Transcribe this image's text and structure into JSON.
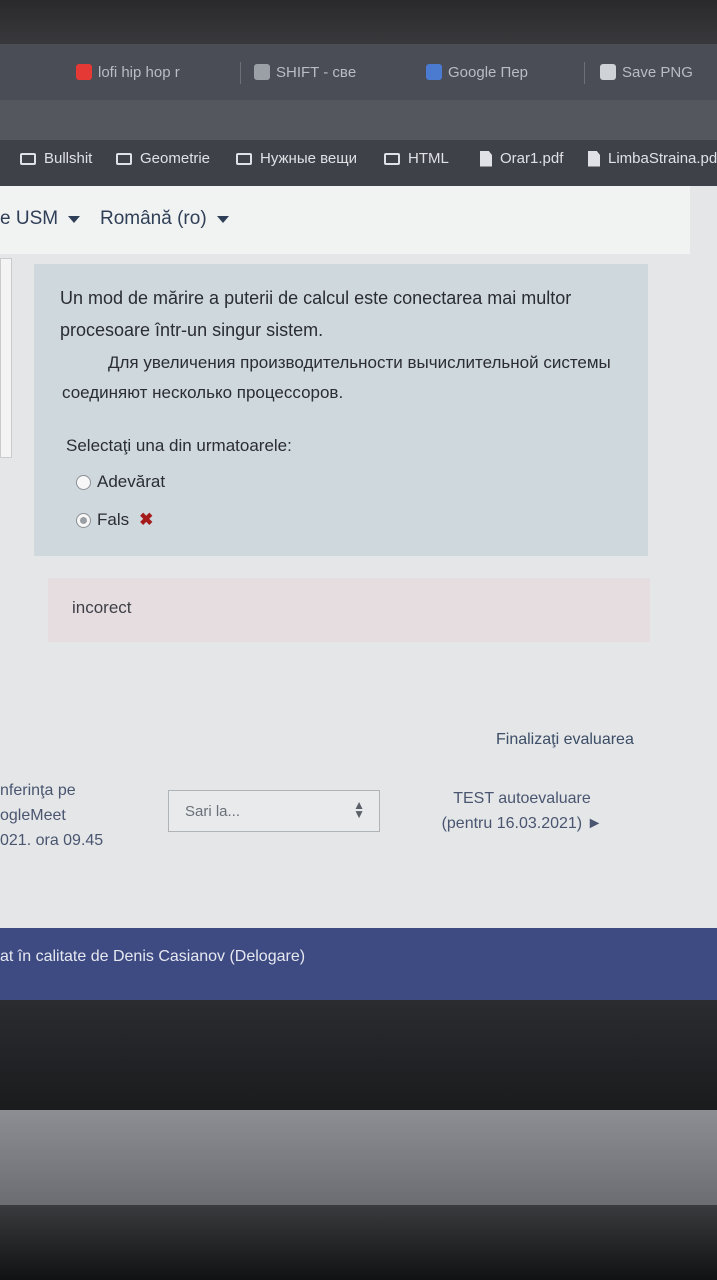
{
  "browser": {
    "tabs": [
      {
        "label": "lofi hip hop r",
        "icon": "youtube-icon",
        "color": "#e53935"
      },
      {
        "label": "SHIFT - свe",
        "icon": "page-icon",
        "color": "#9aa0a6"
      },
      {
        "label": "Google Пер",
        "icon": "translate-icon",
        "color": "#4a7bd0"
      },
      {
        "label": "Save PNG",
        "icon": "image-icon",
        "color": "#cfd2d6"
      }
    ],
    "bookmarks": [
      {
        "label": "Bullshit",
        "icon": "folder-icon"
      },
      {
        "label": "Geometrie",
        "icon": "folder-icon"
      },
      {
        "label": "Нужные вещи",
        "icon": "folder-icon"
      },
      {
        "label": "HTML",
        "icon": "folder-icon"
      },
      {
        "label": "Orar1.pdf",
        "icon": "file-icon"
      },
      {
        "label": "LimbaStraina.pd",
        "icon": "file-icon"
      }
    ]
  },
  "navbar": {
    "site_label": "e USM",
    "language_label": "Română (ro)"
  },
  "question": {
    "text_ro": " Un mod de mărire a puterii de calcul este conectarea mai multor procesoare într-un singur sistem.",
    "text_ru": "Для увеличения производительности вычислительной системы соединяют несколько процессоров.",
    "prompt": "Selectaţi una din urmatoarele:",
    "options": [
      {
        "label": "Adevărat",
        "checked": false
      },
      {
        "label": "Fals",
        "checked": true,
        "mark": "✖"
      }
    ]
  },
  "feedback": {
    "text": "incorect"
  },
  "navigation": {
    "finish_label": "Finalizaţi evaluarea",
    "prev_link": [
      "nferinţa pe",
      "ogleMeet",
      "021.  ora 09.45"
    ],
    "jump_placeholder": "Sari la...",
    "next_link": [
      "TEST autoevaluare",
      "(pentru 16.03.2021) ►"
    ]
  },
  "footer": {
    "text": "at în calitate de Denis Casianov (Delogare)"
  },
  "colors": {
    "question_bg": "#cfd8dd",
    "feedback_bg": "#e6dde1",
    "footer_bg": "#3e4b83",
    "wrong_mark": "#a51a1a"
  }
}
